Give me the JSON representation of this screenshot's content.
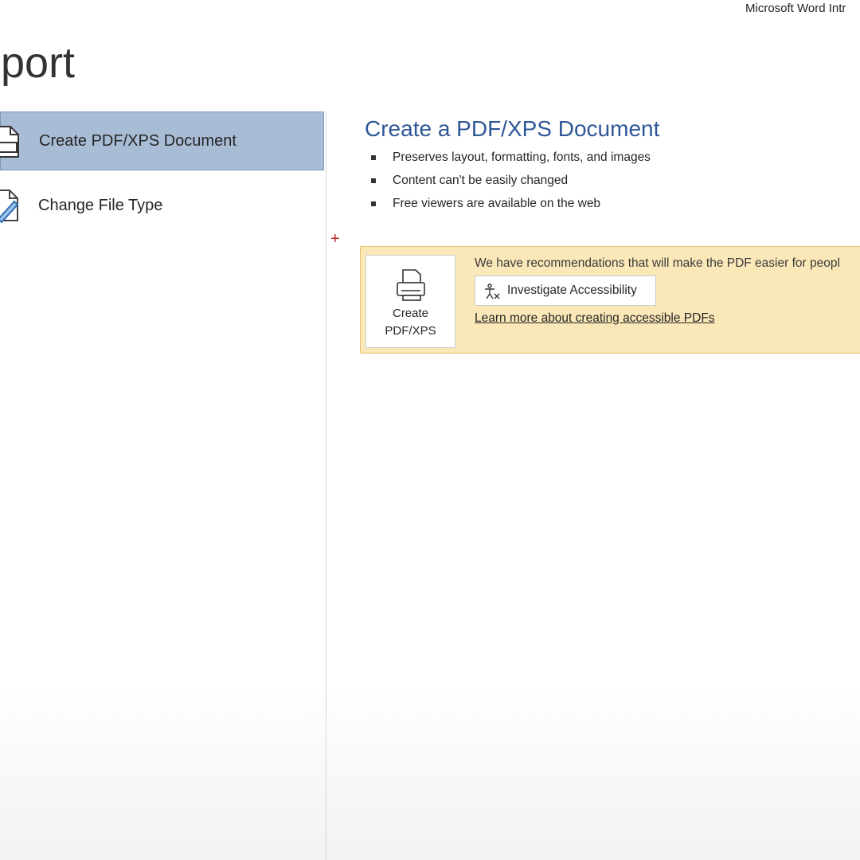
{
  "window": {
    "title": "Microsoft Word Intr"
  },
  "page": {
    "heading": "xport"
  },
  "nav": {
    "items": [
      {
        "label": "Create PDF/XPS Document",
        "icon": "pdf-document-icon",
        "selected": true
      },
      {
        "label": "Change File Type",
        "icon": "change-file-type-icon",
        "selected": false
      }
    ]
  },
  "detail": {
    "title": "Create a PDF/XPS Document",
    "bullets": [
      "Preserves layout, formatting, fonts, and images",
      "Content can't be easily changed",
      "Free viewers are available on the web"
    ],
    "plus_mark": "+",
    "banner": {
      "create_button_label": "Create\nPDF/XPS",
      "create_button_icon": "pdf-printer-icon",
      "recommendation_text": "We have recommendations that will make the PDF easier for peopl",
      "investigate_button_label": "Investigate Accessibility",
      "investigate_button_icon": "accessibility-icon",
      "learn_more_link": "Learn more about creating accessible PDFs"
    }
  },
  "colors": {
    "selected_bg": "#a9bcd6",
    "title_blue": "#2f5797",
    "banner_bg": "#fbe8b8",
    "banner_border": "#e5c274"
  }
}
